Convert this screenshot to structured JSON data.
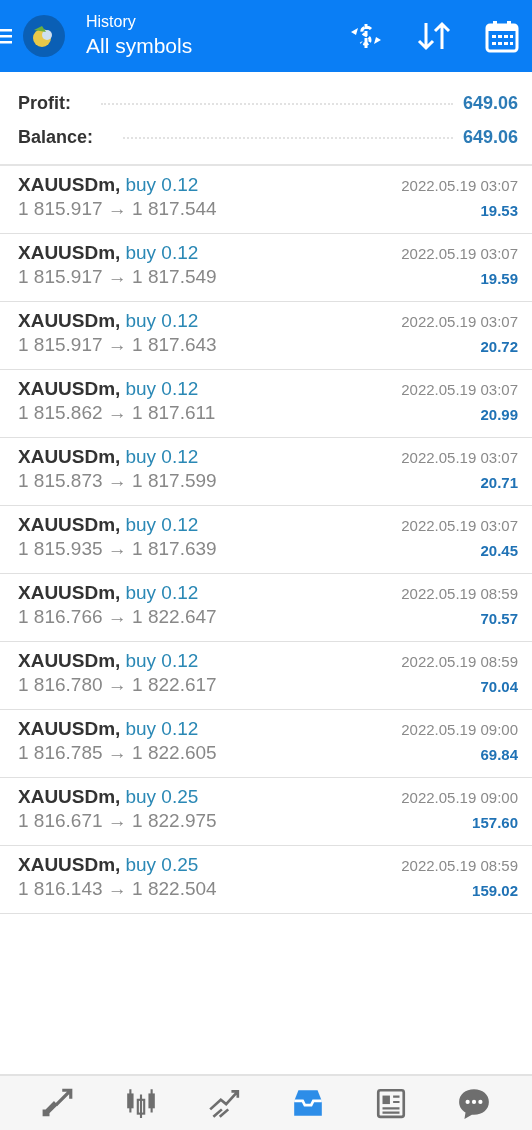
{
  "header": {
    "title": "History",
    "subtitle": "All symbols"
  },
  "summary": [
    {
      "label": "Profit:",
      "value": "649.06"
    },
    {
      "label": "Balance:",
      "value": "649.06"
    }
  ],
  "deals": [
    {
      "symbol": "XAUUSDm,",
      "order": "buy 0.12",
      "prices": "1 815.917 → 1 817.544",
      "time": "2022.05.19 03:07",
      "profit": "19.53"
    },
    {
      "symbol": "XAUUSDm,",
      "order": "buy 0.12",
      "prices": "1 815.917 → 1 817.549",
      "time": "2022.05.19 03:07",
      "profit": "19.59"
    },
    {
      "symbol": "XAUUSDm,",
      "order": "buy 0.12",
      "prices": "1 815.917 → 1 817.643",
      "time": "2022.05.19 03:07",
      "profit": "20.72"
    },
    {
      "symbol": "XAUUSDm,",
      "order": "buy 0.12",
      "prices": "1 815.862 → 1 817.611",
      "time": "2022.05.19 03:07",
      "profit": "20.99"
    },
    {
      "symbol": "XAUUSDm,",
      "order": "buy 0.12",
      "prices": "1 815.873 → 1 817.599",
      "time": "2022.05.19 03:07",
      "profit": "20.71"
    },
    {
      "symbol": "XAUUSDm,",
      "order": "buy 0.12",
      "prices": "1 815.935 → 1 817.639",
      "time": "2022.05.19 03:07",
      "profit": "20.45"
    },
    {
      "symbol": "XAUUSDm,",
      "order": "buy 0.12",
      "prices": "1 816.766 → 1 822.647",
      "time": "2022.05.19 08:59",
      "profit": "70.57"
    },
    {
      "symbol": "XAUUSDm,",
      "order": "buy 0.12",
      "prices": "1 816.780 → 1 822.617",
      "time": "2022.05.19 08:59",
      "profit": "70.04"
    },
    {
      "symbol": "XAUUSDm,",
      "order": "buy 0.12",
      "prices": "1 816.785 → 1 822.605",
      "time": "2022.05.19 09:00",
      "profit": "69.84"
    },
    {
      "symbol": "XAUUSDm,",
      "order": "buy 0.25",
      "prices": "1 816.671 → 1 822.975",
      "time": "2022.05.19 09:00",
      "profit": "157.60"
    },
    {
      "symbol": "XAUUSDm,",
      "order": "buy 0.25",
      "prices": "1 816.143 → 1 822.504",
      "time": "2022.05.19 08:59",
      "profit": "159.02"
    }
  ],
  "nav": [
    {
      "kind": "quotes",
      "selected": false
    },
    {
      "kind": "chart",
      "selected": false
    },
    {
      "kind": "trade",
      "selected": false
    },
    {
      "kind": "history",
      "selected": true
    },
    {
      "kind": "news",
      "selected": false
    },
    {
      "kind": "chat",
      "selected": false
    }
  ]
}
